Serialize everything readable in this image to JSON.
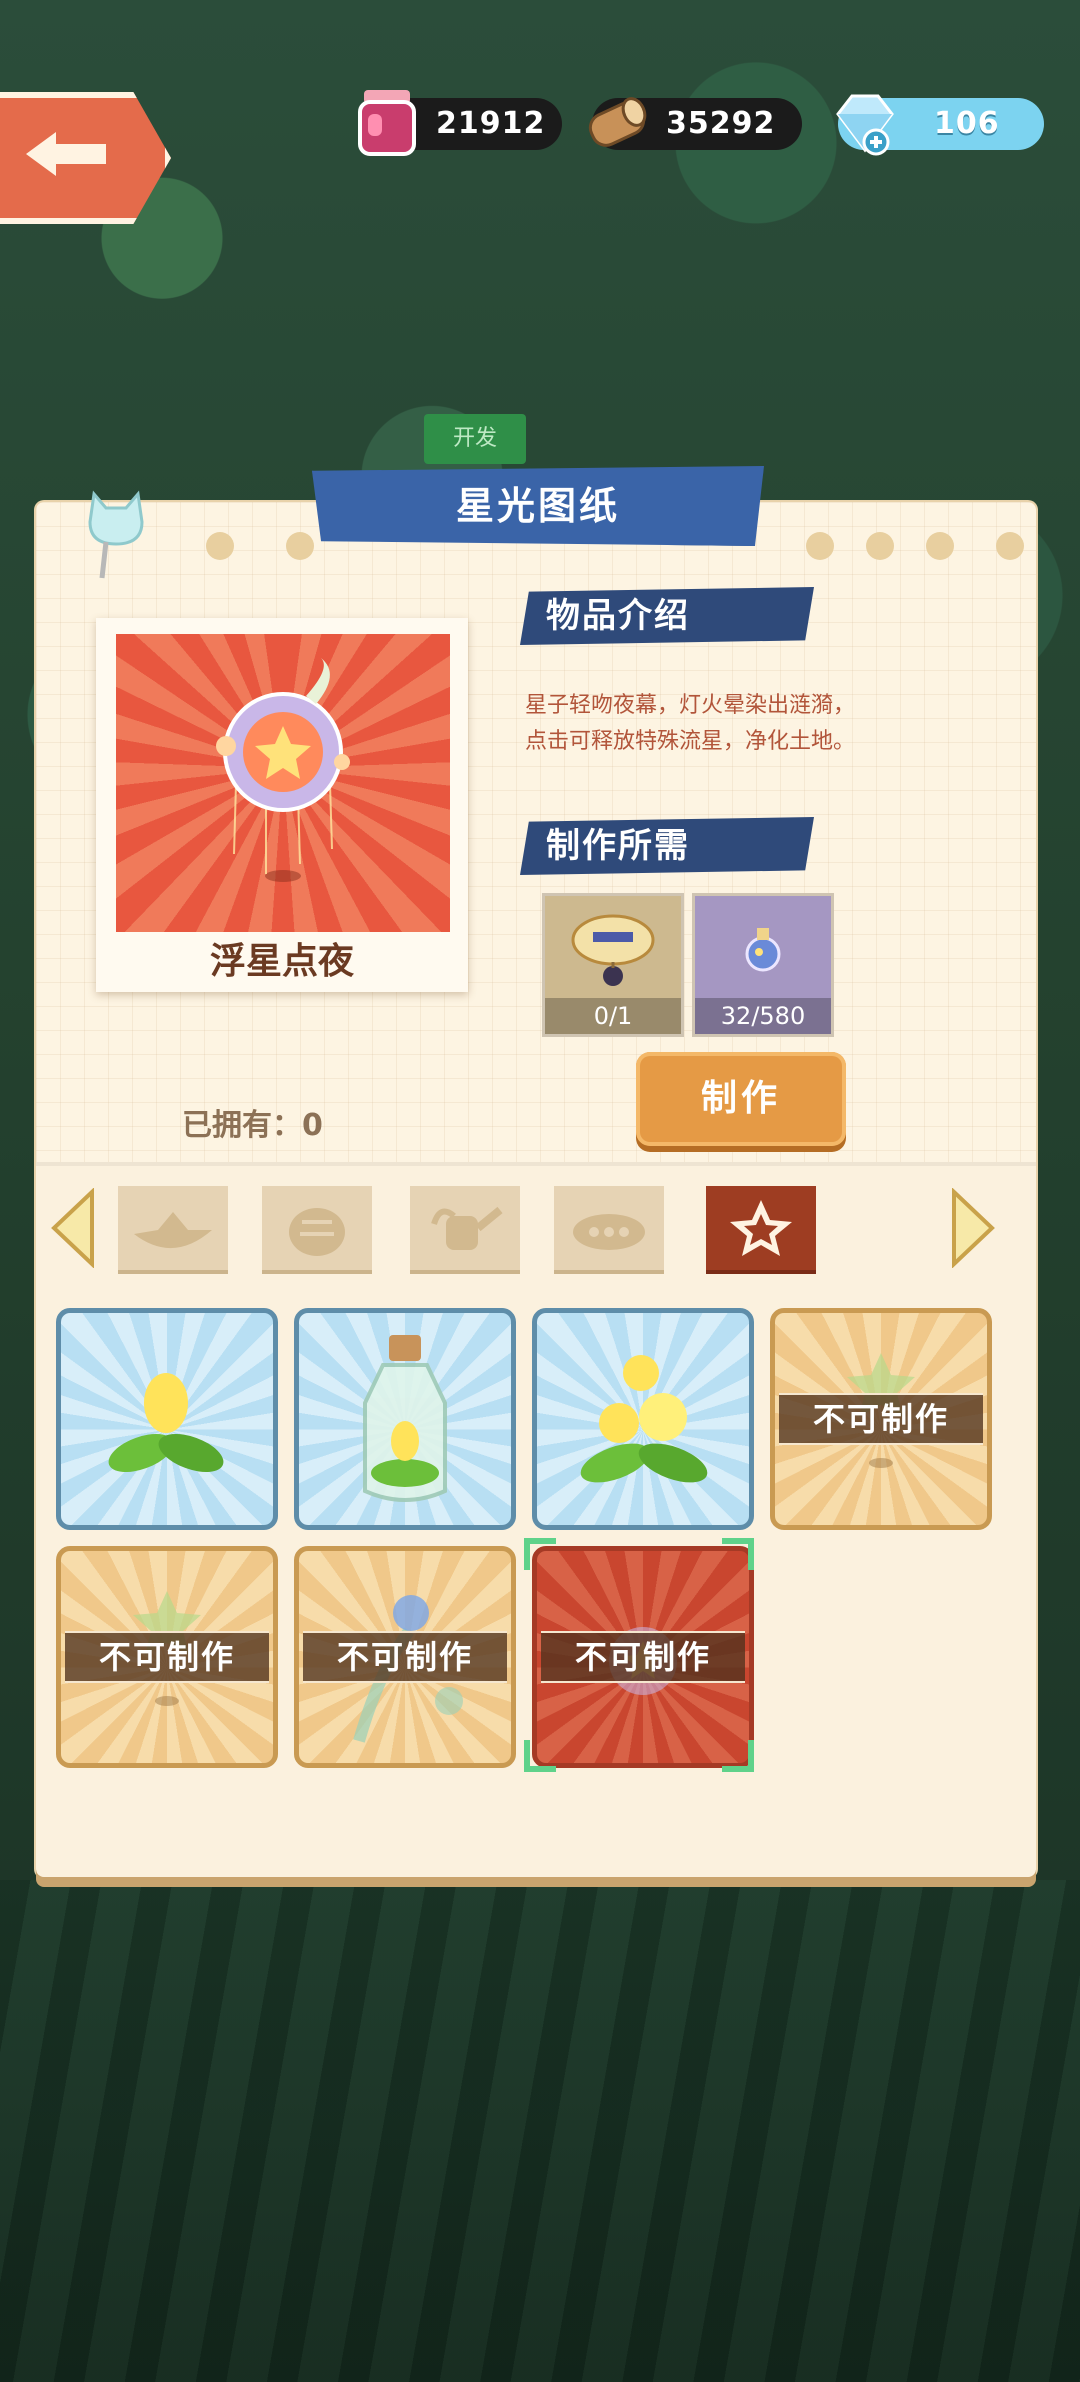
{
  "resources": {
    "jam": "21912",
    "wood": "35292",
    "gems": "106"
  },
  "dev_label": "开发",
  "panel": {
    "title": "星光图纸",
    "item_name": "浮星点夜",
    "intro_heading": "物品介绍",
    "description_line1": "星子轻吻夜幕，灯火晕染出涟漪，",
    "description_line2": "点击可释放特殊流星，净化土地。",
    "materials_heading": "制作所需",
    "materials": [
      {
        "icon": "lantern-icon",
        "count": "0/1"
      },
      {
        "icon": "potion-icon",
        "count": "32/580"
      }
    ],
    "make_button": "制作",
    "owned_text": "已拥有：0"
  },
  "tabs": [
    "boat-icon",
    "basket-icon",
    "watering-can-icon",
    "cloud-icon",
    "star-icon"
  ],
  "grid": {
    "locked_label": "不可制作",
    "cells": [
      {
        "state": "ok",
        "icon": "yellow-bud-icon"
      },
      {
        "state": "ok",
        "icon": "bottle-sprout-icon"
      },
      {
        "state": "ok",
        "icon": "yellow-flowers-icon"
      },
      {
        "state": "locked",
        "icon": "star-sprout-icon"
      },
      {
        "state": "locked",
        "icon": "star-sprout-icon"
      },
      {
        "state": "locked",
        "icon": "blue-flower-icon"
      },
      {
        "state": "selected-locked",
        "icon": "star-orb-icon"
      }
    ]
  },
  "colors": {
    "accent_blue": "#3a64a8",
    "make_orange": "#e59a45",
    "paper": "#fdf4e2"
  }
}
